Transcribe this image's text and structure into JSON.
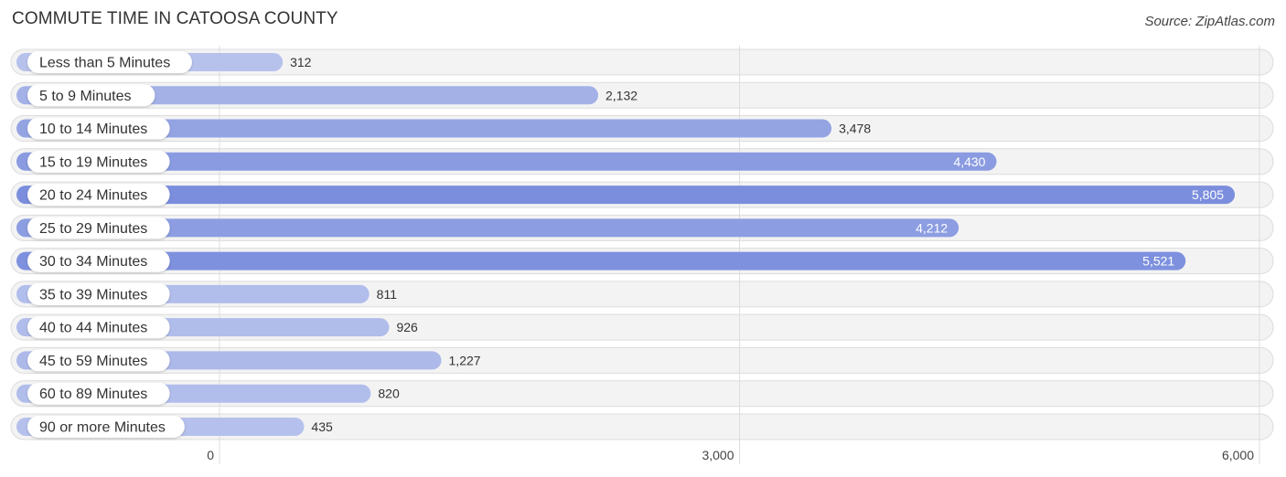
{
  "chart_data": {
    "type": "bar",
    "orientation": "horizontal",
    "title": "COMMUTE TIME IN CATOOSA COUNTY",
    "source": "Source: ZipAtlas.com",
    "categories": [
      "Less than 5 Minutes",
      "5 to 9 Minutes",
      "10 to 14 Minutes",
      "15 to 19 Minutes",
      "20 to 24 Minutes",
      "25 to 29 Minutes",
      "30 to 34 Minutes",
      "35 to 39 Minutes",
      "40 to 44 Minutes",
      "45 to 59 Minutes",
      "60 to 89 Minutes",
      "90 or more Minutes"
    ],
    "values": [
      312,
      2132,
      3478,
      4430,
      5805,
      4212,
      5521,
      811,
      926,
      1227,
      820,
      435
    ],
    "value_labels": [
      "312",
      "2,132",
      "3,478",
      "4,430",
      "5,805",
      "4,212",
      "5,521",
      "811",
      "926",
      "1,227",
      "820",
      "435"
    ],
    "xlim": [
      0,
      6000
    ],
    "xticks": [
      0,
      3000,
      6000
    ],
    "xtick_labels": [
      "0",
      "3,000",
      "6,000"
    ],
    "xlabel": "",
    "ylabel": "",
    "grid": true,
    "colors": {
      "bar_light": "#b7c2ec",
      "bar_dark": "#7b8edd",
      "track": "#f3f3f3",
      "grid": "#dddddd"
    }
  }
}
